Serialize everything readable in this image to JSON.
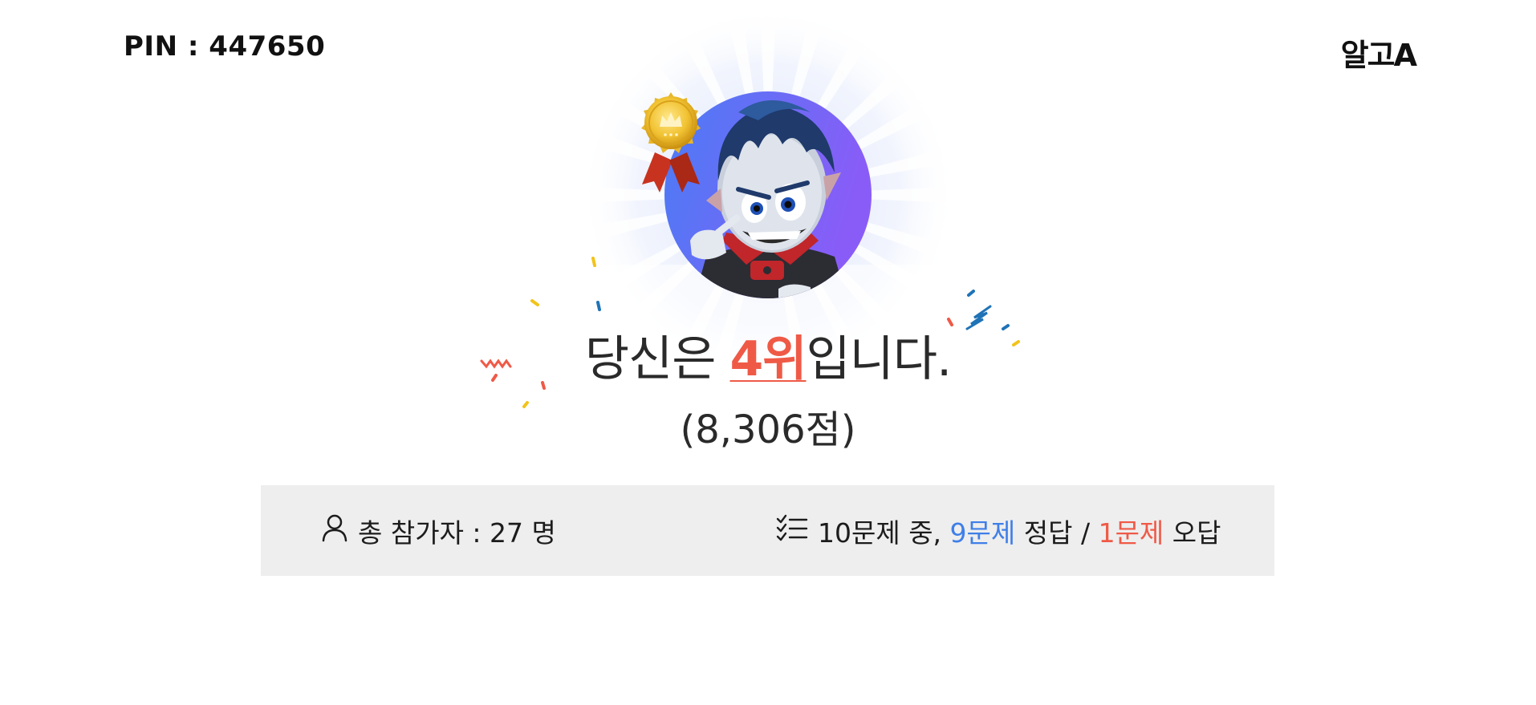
{
  "header": {
    "pin_label": "PIN : 447650",
    "brand": "알고A"
  },
  "result": {
    "rank_prefix": "당신은 ",
    "rank_value": "4위",
    "rank_suffix": "입니다.",
    "score": "(8,306점)"
  },
  "stats": {
    "participants_label": "총 참가자 : 27 명",
    "total_questions": "10문제 중, ",
    "correct": "9문제",
    "correct_suffix": " 정답 / ",
    "wrong": "1문제",
    "wrong_suffix": " 오답"
  },
  "colors": {
    "accent_red": "#ef5a47",
    "accent_blue": "#3f7fe8",
    "stats_background": "#eeeeee"
  },
  "icons": [
    "medal-icon",
    "avatar-character",
    "user-icon",
    "checklist-icon",
    "confetti"
  ]
}
